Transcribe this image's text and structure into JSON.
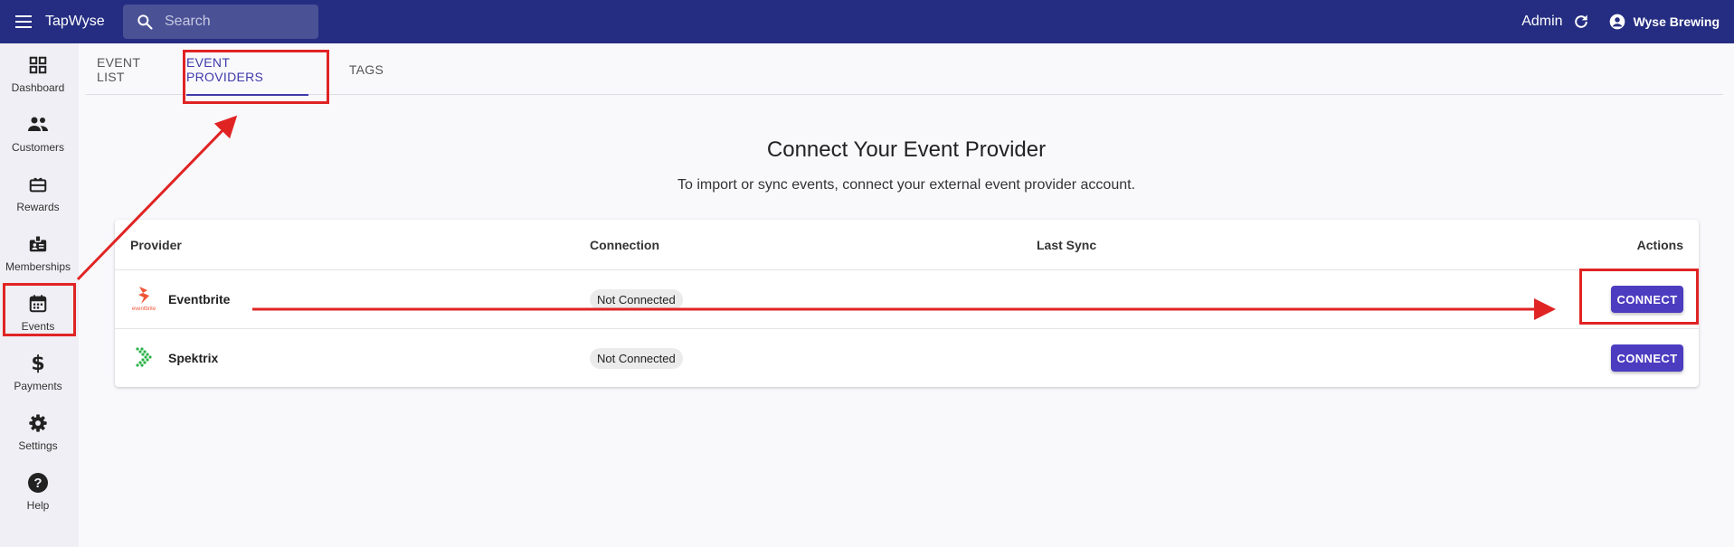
{
  "appbar": {
    "brand": "TapWyse",
    "search_placeholder": "Search",
    "admin_label": "Admin",
    "account_name": "Wyse Brewing",
    "background": "#252d82"
  },
  "sidebar": {
    "items": [
      {
        "label": "Dashboard",
        "icon": "dashboard-icon"
      },
      {
        "label": "Customers",
        "icon": "people-icon"
      },
      {
        "label": "Rewards",
        "icon": "gift-card-icon"
      },
      {
        "label": "Memberships",
        "icon": "membership-badge-icon"
      },
      {
        "label": "Events",
        "icon": "calendar-icon",
        "selected": true
      },
      {
        "label": "Payments",
        "icon": "dollar-icon"
      },
      {
        "label": "Settings",
        "icon": "gear-icon"
      },
      {
        "label": "Help",
        "icon": "help-circle-icon"
      }
    ]
  },
  "tabs": [
    {
      "label": "EVENT LIST"
    },
    {
      "label": "EVENT PROVIDERS",
      "active": true
    },
    {
      "label": "TAGS"
    }
  ],
  "page": {
    "heading": "Connect Your Event Provider",
    "subheading": "To import or sync events, connect your external event provider account."
  },
  "table": {
    "columns": [
      "Provider",
      "Connection",
      "Last Sync",
      "Actions"
    ],
    "rows": [
      {
        "provider": "Eventbrite",
        "connection": "Not Connected",
        "last_sync": "",
        "action": "CONNECT",
        "logo": "eventbrite-logo"
      },
      {
        "provider": "Spektrix",
        "connection": "Not Connected",
        "last_sync": "",
        "action": "CONNECT",
        "logo": "spektrix-logo"
      }
    ]
  },
  "colors": {
    "accent": "#3f3aa8",
    "button": "#4c3cc0",
    "annotation": "#e02424"
  }
}
